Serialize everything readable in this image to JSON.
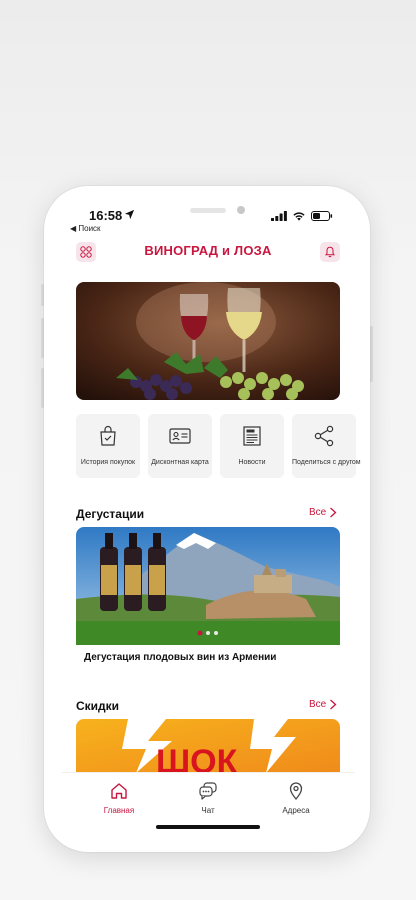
{
  "status": {
    "time": "16:58",
    "back_label": "◀ Поиск"
  },
  "app": {
    "title": "ВИНОГРАД и ЛОЗА"
  },
  "quick_actions": [
    {
      "label": "История покупок",
      "icon": "shopping-bag-icon"
    },
    {
      "label": "Дисконтная карта",
      "icon": "id-card-icon"
    },
    {
      "label": "Новости",
      "icon": "newspaper-icon"
    },
    {
      "label": "Поделиться с другом",
      "icon": "share-icon"
    }
  ],
  "tastings": {
    "title": "Дегустации",
    "see_all": "Все",
    "card_title": "Дегустация плодовых вин из Армении",
    "carousel_active_index": 0
  },
  "discounts": {
    "title": "Скидки",
    "see_all": "Все",
    "promo_text": "ШОК"
  },
  "tabbar": {
    "items": [
      {
        "label": "Главная",
        "icon": "home-icon",
        "active": true
      },
      {
        "label": "Чат",
        "icon": "chat-icon",
        "active": false
      },
      {
        "label": "Адреса",
        "icon": "location-pin-icon",
        "active": false
      }
    ]
  },
  "colors": {
    "accent": "#c8163f",
    "tile_bg": "#f3f3f3",
    "badge_bg": "#f6e4ea"
  }
}
